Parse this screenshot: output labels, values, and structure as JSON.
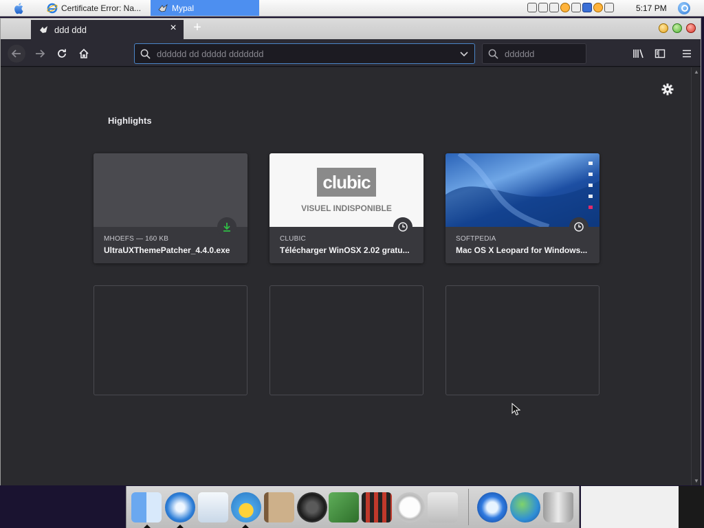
{
  "menubar": {
    "tasks": [
      {
        "label": "Certificate Error: Na..."
      },
      {
        "label": "Mypal"
      }
    ],
    "clock": "5:17 PM"
  },
  "tab": {
    "title": "ddd ddd"
  },
  "navbar": {
    "url_placeholder": "dddddd dd ddddd ddddddd",
    "search_placeholder": "dddddd"
  },
  "highlights": {
    "title": "Highlights",
    "cards": [
      {
        "source": "MHOEFS — 160 KB",
        "title": "UltraUXThemePatcher_4.4.0.exe",
        "badge": "download-icon"
      },
      {
        "source": "CLUBIC",
        "title": "Télécharger WinOSX 2.02 gratu...",
        "badge": "clock-icon",
        "logo": "clubic",
        "placeholder": "VISUEL INDISPONIBLE"
      },
      {
        "source": "SOFTPEDIA",
        "title": "Mac OS X Leopard for Windows...",
        "badge": "clock-icon"
      }
    ]
  },
  "colors": {
    "accent": "#4b86c9",
    "download_green": "#2fbf45",
    "content_bg": "#2a2a2e"
  },
  "dock": {
    "icons": [
      "finder-icon",
      "safari-icon",
      "mail-icon",
      "ichat-icon",
      "address-book-icon",
      "itunes-icon",
      "iphoto-icon",
      "imovie-icon",
      "time-icon",
      "utilities-icon",
      "quicktime-icon",
      "network-icon",
      "trash-icon"
    ]
  }
}
